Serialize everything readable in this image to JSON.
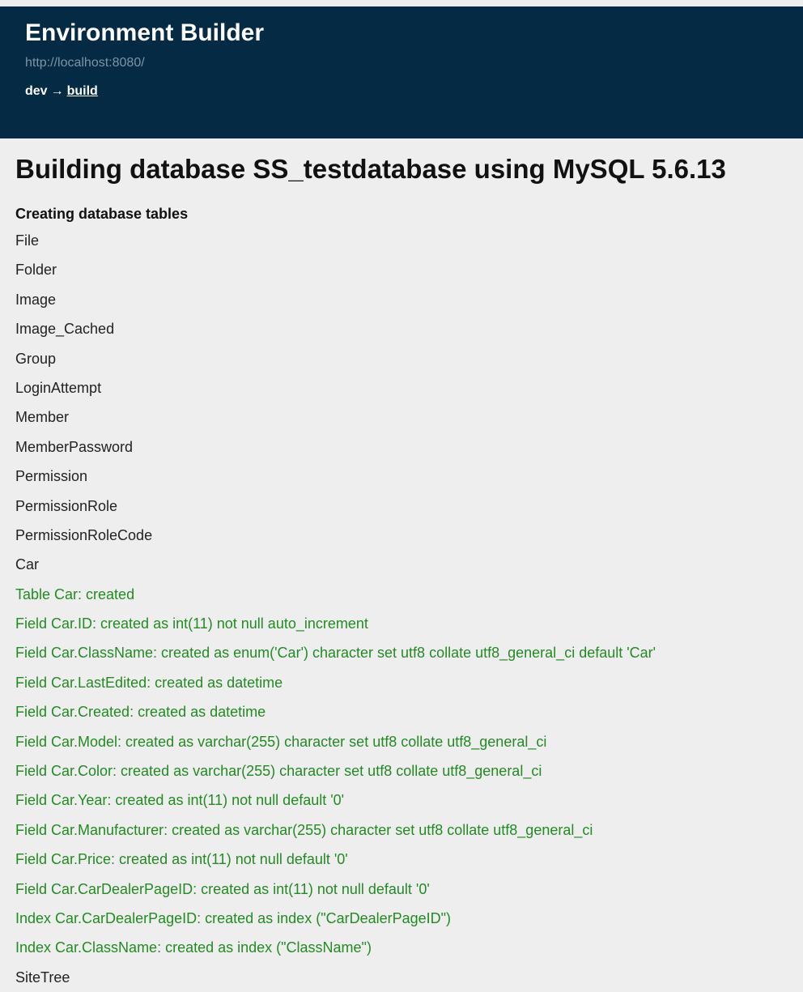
{
  "colors": {
    "header_bg": "#042a44",
    "page_bg": "#eeeeee",
    "created_text": "#238b23"
  },
  "header": {
    "title": "Environment Builder",
    "url": "http://localhost:8080/",
    "breadcrumb": {
      "root": "dev",
      "separator": "→",
      "current": "build"
    }
  },
  "main": {
    "heading": "Building database SS_testdatabase using MySQL 5.6.13",
    "section_title": "Creating database tables",
    "lines": [
      {
        "text": "File",
        "status": "plain"
      },
      {
        "text": "Folder",
        "status": "plain"
      },
      {
        "text": "Image",
        "status": "plain"
      },
      {
        "text": "Image_Cached",
        "status": "plain"
      },
      {
        "text": "Group",
        "status": "plain"
      },
      {
        "text": "LoginAttempt",
        "status": "plain"
      },
      {
        "text": "Member",
        "status": "plain"
      },
      {
        "text": "MemberPassword",
        "status": "plain"
      },
      {
        "text": "Permission",
        "status": "plain"
      },
      {
        "text": "PermissionRole",
        "status": "plain"
      },
      {
        "text": "PermissionRoleCode",
        "status": "plain"
      },
      {
        "text": "Car",
        "status": "plain"
      },
      {
        "text": "Table Car: created",
        "status": "created"
      },
      {
        "text": "Field Car.ID: created as int(11) not null auto_increment",
        "status": "created"
      },
      {
        "text": "Field Car.ClassName: created as enum('Car') character set utf8 collate utf8_general_ci default 'Car'",
        "status": "created"
      },
      {
        "text": "Field Car.LastEdited: created as datetime",
        "status": "created"
      },
      {
        "text": "Field Car.Created: created as datetime",
        "status": "created"
      },
      {
        "text": "Field Car.Model: created as varchar(255) character set utf8 collate utf8_general_ci",
        "status": "created"
      },
      {
        "text": "Field Car.Color: created as varchar(255) character set utf8 collate utf8_general_ci",
        "status": "created"
      },
      {
        "text": "Field Car.Year: created as int(11) not null default '0'",
        "status": "created"
      },
      {
        "text": "Field Car.Manufacturer: created as varchar(255) character set utf8 collate utf8_general_ci",
        "status": "created"
      },
      {
        "text": "Field Car.Price: created as int(11) not null default '0'",
        "status": "created"
      },
      {
        "text": "Field Car.CarDealerPageID: created as int(11) not null default '0'",
        "status": "created"
      },
      {
        "text": "Index Car.CarDealerPageID: created as index (\"CarDealerPageID\")",
        "status": "created"
      },
      {
        "text": "Index Car.ClassName: created as index (\"ClassName\")",
        "status": "created"
      },
      {
        "text": "SiteTree",
        "status": "plain"
      }
    ]
  }
}
